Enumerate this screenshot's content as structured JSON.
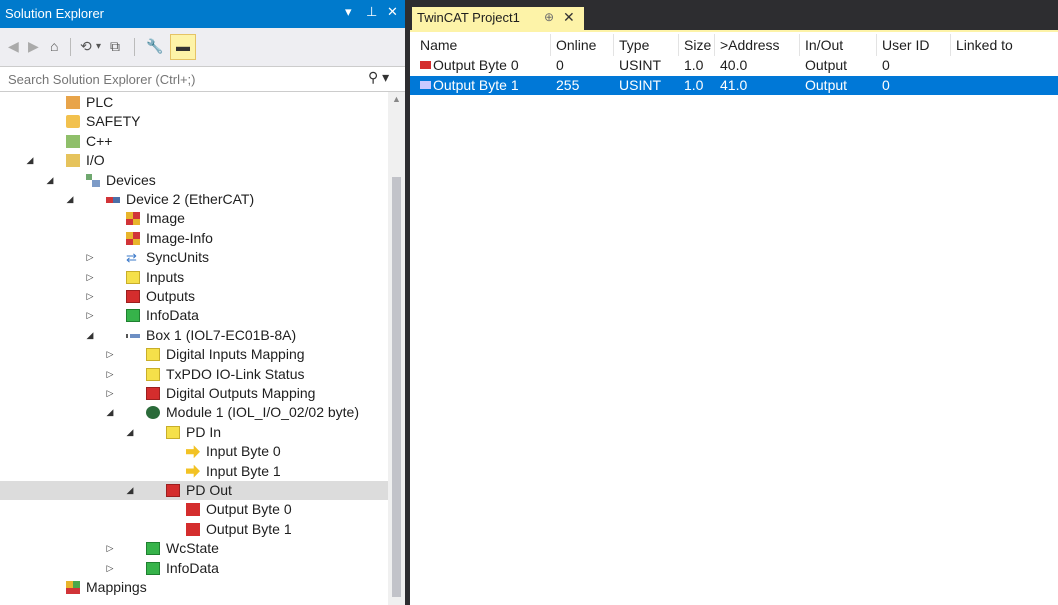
{
  "solution_explorer": {
    "title": "Solution Explorer",
    "controls": {
      "dropdown": "▾",
      "pin": "⊥",
      "close": "✕"
    },
    "search_placeholder": "Search Solution Explorer (Ctrl+;)",
    "tree": [
      {
        "label": "PLC",
        "icon": "plc-icon"
      },
      {
        "label": "SAFETY",
        "icon": "safety-icon"
      },
      {
        "label": "C++",
        "icon": "cpp-icon"
      },
      {
        "label": "I/O",
        "icon": "io-icon",
        "expander": "◢"
      },
      {
        "label": "Devices",
        "icon": "devices-icon",
        "expander": "◢"
      },
      {
        "label": "Device 2 (EtherCAT)",
        "icon": "ethercat-icon",
        "expander": "◢"
      },
      {
        "label": "Image",
        "icon": "image-icon"
      },
      {
        "label": "Image-Info",
        "icon": "image-info-icon"
      },
      {
        "label": "SyncUnits",
        "icon": "syncunits-icon",
        "expander": "▷"
      },
      {
        "label": "Inputs",
        "icon": "inputs-icon",
        "expander": "▷"
      },
      {
        "label": "Outputs",
        "icon": "outputs-icon",
        "expander": "▷"
      },
      {
        "label": "InfoData",
        "icon": "infodata-icon",
        "expander": "▷"
      },
      {
        "label": "Box 1 (IOL7-EC01B-8A)",
        "icon": "box-icon",
        "expander": "◢"
      },
      {
        "label": "Digital Inputs Mapping",
        "icon": "inputs-icon",
        "expander": "▷"
      },
      {
        "label": "TxPDO IO-Link Status",
        "icon": "inputs-icon",
        "expander": "▷"
      },
      {
        "label": "Digital Outputs Mapping",
        "icon": "outputs-icon",
        "expander": "▷"
      },
      {
        "label": "Module 1 (IOL_I/O_02/02 byte)",
        "icon": "module-icon",
        "expander": "◢"
      },
      {
        "label": "PD In",
        "icon": "inputs-icon",
        "expander": "◢"
      },
      {
        "label": "Input Byte 0",
        "icon": "input-var-icon"
      },
      {
        "label": "Input Byte 1",
        "icon": "input-var-icon"
      },
      {
        "label": "PD Out",
        "icon": "outputs-icon",
        "expander": "◢",
        "selected": true
      },
      {
        "label": "Output Byte 0",
        "icon": "output-var-icon"
      },
      {
        "label": "Output Byte 1",
        "icon": "output-var-icon"
      },
      {
        "label": "WcState",
        "icon": "infodata-icon",
        "expander": "▷"
      },
      {
        "label": "InfoData",
        "icon": "infodata-icon",
        "expander": "▷"
      },
      {
        "label": "Mappings",
        "icon": "mappings-icon"
      }
    ]
  },
  "document": {
    "tab_title": "TwinCAT Project1",
    "tab_pin": "⊕",
    "tab_close": "✕",
    "columns": [
      "Name",
      "Online",
      "Type",
      "Size",
      ">Address",
      "In/Out",
      "User ID",
      "Linked to"
    ],
    "rows": [
      {
        "name": "Output Byte 0",
        "online": "0",
        "type": "USINT",
        "size": "1.0",
        "address": "40.0",
        "inout": "Output",
        "userid": "0",
        "linked": "",
        "selected": false
      },
      {
        "name": "Output Byte 1",
        "online": "255",
        "type": "USINT",
        "size": "1.0",
        "address": "41.0",
        "inout": "Output",
        "userid": "0",
        "linked": "",
        "selected": true
      }
    ]
  },
  "colors": {
    "accent": "#007acc",
    "selection": "#0078d7",
    "tab": "#fdf3a8"
  }
}
